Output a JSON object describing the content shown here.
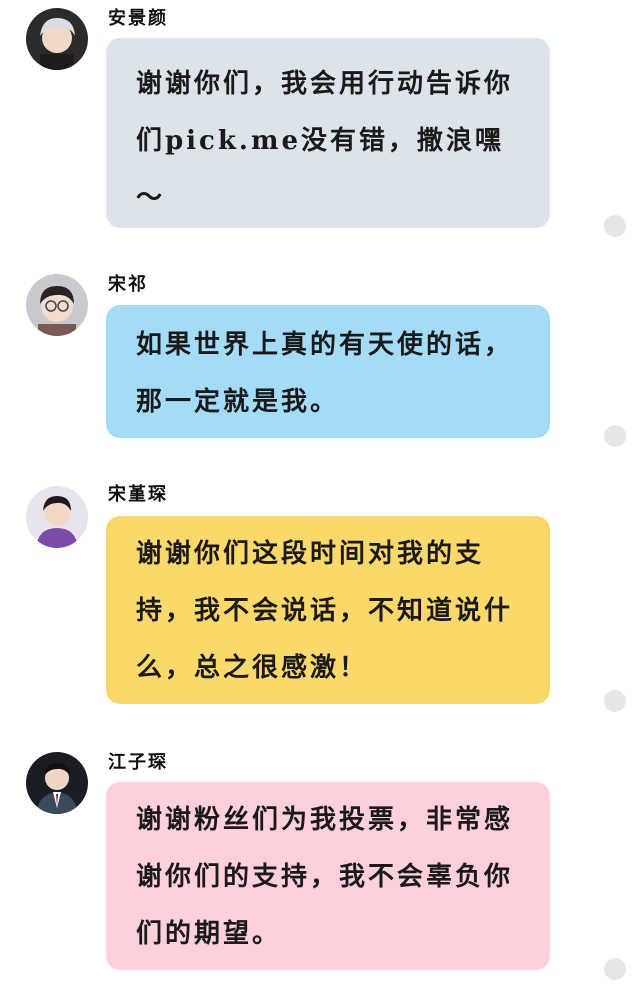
{
  "messages": [
    {
      "name": "安景颜",
      "text": "谢谢你们，我会用行动告诉你们pick.me没有错，撒浪嘿～",
      "bubble_color": "#dde3eb",
      "avatar_icon": "avatar-silver-hair"
    },
    {
      "name": "宋祁",
      "text": "如果世界上真的有天使的话，那一定就是我。",
      "bubble_color": "#a4dcf8",
      "avatar_icon": "avatar-glasses"
    },
    {
      "name": "宋堇琛",
      "text": "谢谢你们这段时间对我的支持，我不会说话，不知道说什么，总之很感激！",
      "bubble_color": "#fbd86a",
      "avatar_icon": "avatar-purple-shirt"
    },
    {
      "name": "江子琛",
      "text": "谢谢粉丝们为我投票，非常感谢你们的支持，我不会辜负你们的期望。",
      "bubble_color": "#fdd0dc",
      "avatar_icon": "avatar-suit"
    }
  ]
}
